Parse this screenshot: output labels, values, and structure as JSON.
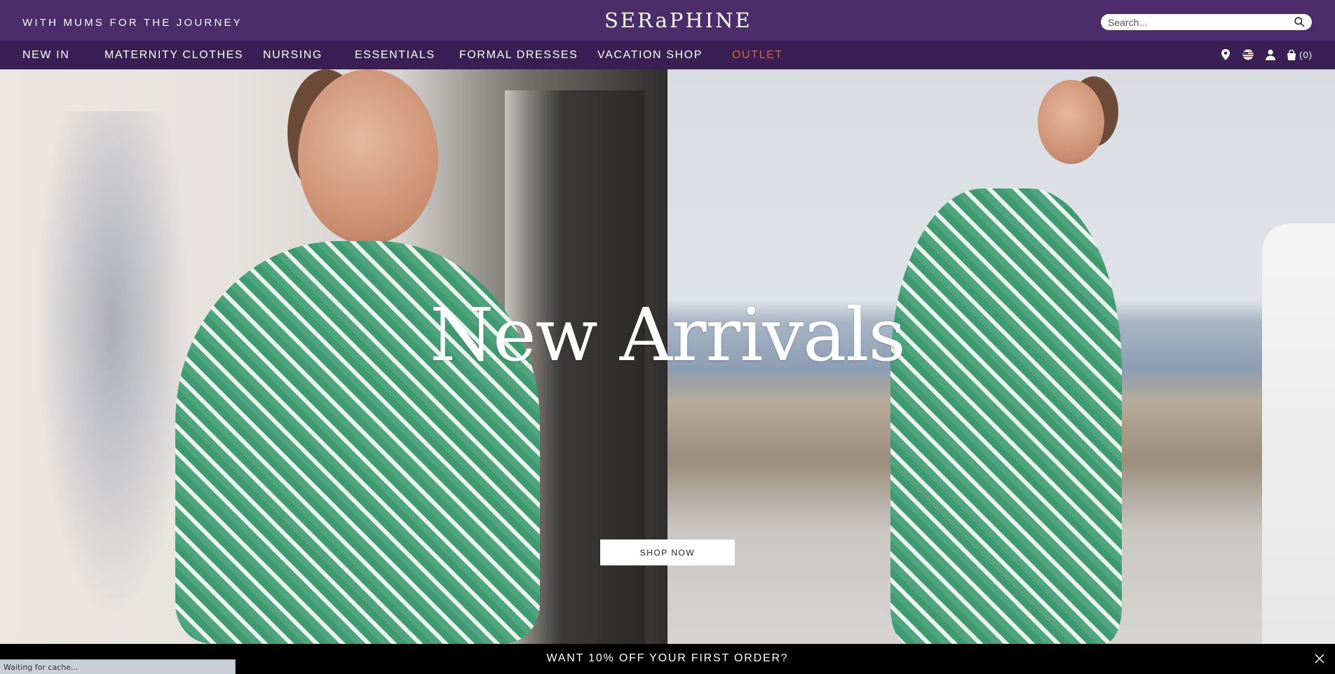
{
  "header": {
    "tagline": "WITH MUMS FOR THE JOURNEY",
    "logo": "SERaPHINE",
    "search_placeholder": "Search..."
  },
  "nav": {
    "items": [
      {
        "label": "NEW IN"
      },
      {
        "label": "MATERNITY CLOTHES"
      },
      {
        "label": "NURSING"
      },
      {
        "label": "ESSENTIALS"
      },
      {
        "label": "FORMAL DRESSES"
      },
      {
        "label": "VACATION SHOP"
      },
      {
        "label": "OUTLET"
      }
    ],
    "outlet_color": "#d9603b",
    "icons": [
      "location-pin-icon",
      "us-flag-icon",
      "account-icon",
      "shopping-bag-icon"
    ],
    "cart_count": "(0)"
  },
  "hero": {
    "title": "New Arrivals",
    "cta": "SHOP NOW"
  },
  "offer_bar": {
    "text": "WANT 10% OFF YOUR FIRST ORDER?"
  },
  "status_bar": {
    "text": "Waiting for cache..."
  },
  "colors": {
    "header_bg": "#4b2d6b",
    "nav_bg": "#3a1f55",
    "offer_bg": "#000000"
  }
}
